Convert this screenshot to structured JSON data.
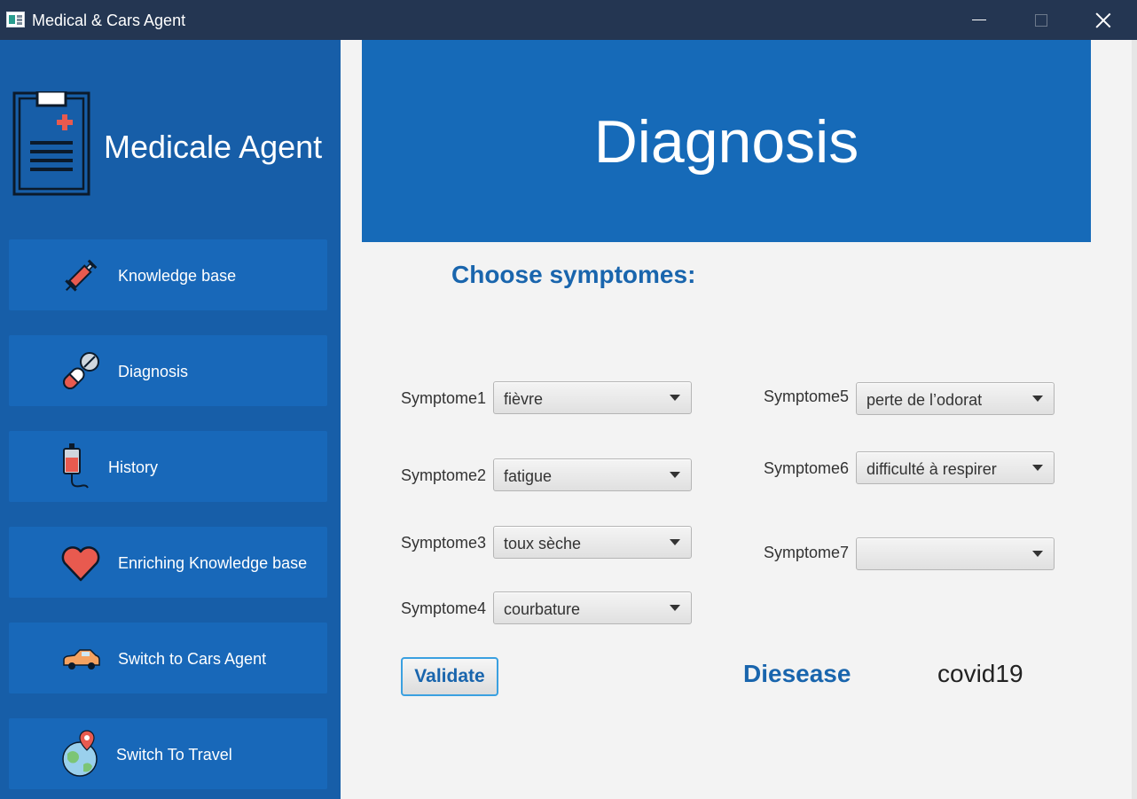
{
  "window": {
    "title": "Medical & Cars Agent"
  },
  "sidebar": {
    "brand_title": "Medicale Agent",
    "items": [
      {
        "label": "Knowledge base",
        "icon": "syringe-icon"
      },
      {
        "label": "Diagnosis",
        "icon": "pills-icon"
      },
      {
        "label": "History",
        "icon": "blood-bag-icon"
      },
      {
        "label": "Enriching Knowledge base",
        "icon": "heart-icon"
      },
      {
        "label": "Switch to Cars Agent",
        "icon": "car-icon"
      },
      {
        "label": "Switch To Travel",
        "icon": "globe-pin-icon"
      }
    ]
  },
  "main": {
    "banner_title": "Diagnosis",
    "section_title": "Choose symptomes:",
    "symptoms": [
      {
        "label": "Symptome1",
        "value": "fièvre"
      },
      {
        "label": "Symptome2",
        "value": "fatigue"
      },
      {
        "label": "Symptome3",
        "value": "toux sèche"
      },
      {
        "label": "Symptome4",
        "value": "courbature"
      },
      {
        "label": "Symptome5",
        "value": "perte de l’odorat"
      },
      {
        "label": "Symptome6",
        "value": "difficulté à respirer"
      },
      {
        "label": "Symptome7",
        "value": ""
      }
    ],
    "validate_label": "Validate",
    "disease_label": "Diesease",
    "disease_value": "covid19"
  },
  "colors": {
    "titlebar": "#243652",
    "sidebar": "#175ea8",
    "nav_button": "#1868b9",
    "banner": "#166ab8",
    "accent_text": "#1965ad"
  }
}
